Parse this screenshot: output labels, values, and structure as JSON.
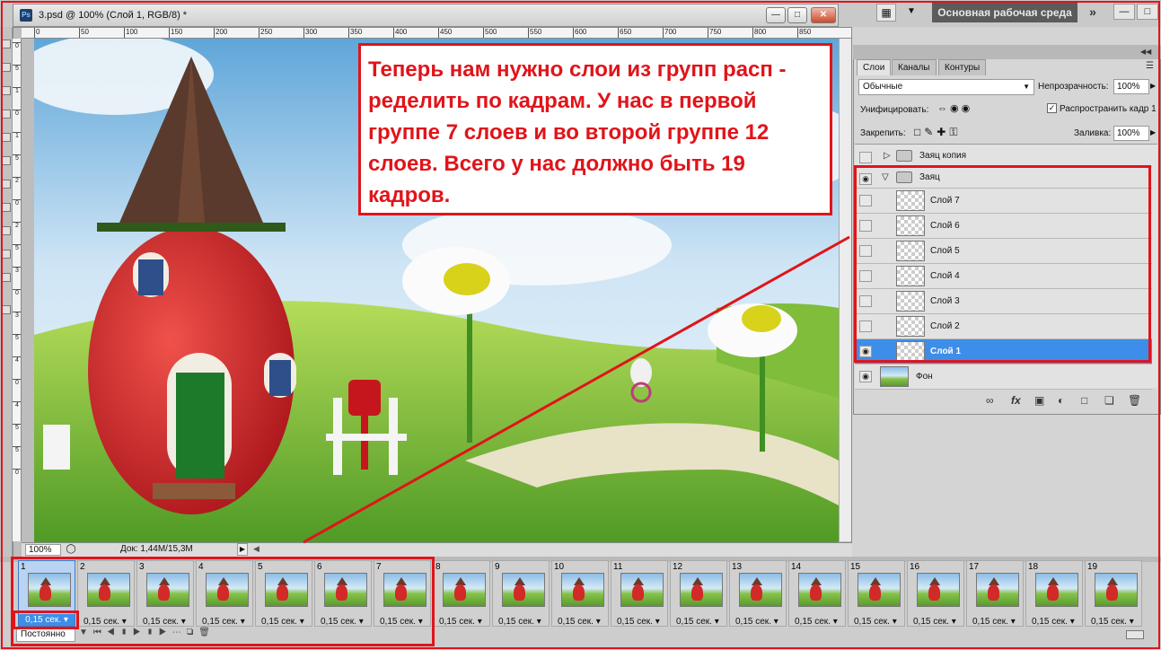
{
  "document": {
    "title": "3.psd @ 100% (Слой 1, RGB/8) *",
    "zoom": "100%",
    "doc_size": "Док: 1,44M/15,3M",
    "ruler_top": [
      "0",
      "50",
      "100",
      "150",
      "200",
      "250",
      "300",
      "350",
      "400",
      "450",
      "500",
      "550",
      "600",
      "650",
      "700",
      "750",
      "800",
      "850"
    ],
    "ruler_left": [
      "0",
      "5",
      "1",
      "0",
      "1",
      "5",
      "2",
      "0",
      "2",
      "5",
      "3",
      "0",
      "3",
      "5",
      "4",
      "0",
      "4",
      "5",
      "5",
      "0"
    ]
  },
  "workspace": {
    "label": "Основная рабочая среда"
  },
  "annotation": {
    "text": "Теперь нам нужно слои из групп расп -\nределить по кадрам. У нас в первой\nгруппе 7 слоев и во второй группе 12\nслоев. Всего у нас должно быть 19\nкадров."
  },
  "layers_panel": {
    "tabs": [
      "Слои",
      "Каналы",
      "Контуры"
    ],
    "blend_mode": "Обычные",
    "opacity_label": "Непрозрачность:",
    "opacity": "100%",
    "unify_label": "Унифицировать:",
    "propagate_label": "Распространить кадр 1",
    "lock_label": "Закрепить:",
    "fill_label": "Заливка:",
    "fill": "100%",
    "layers": [
      {
        "name": "Заяц копия",
        "type": "group",
        "visible": false,
        "expanded": false
      },
      {
        "name": "Заяц",
        "type": "group",
        "visible": true,
        "expanded": true
      },
      {
        "name": "Слой 7",
        "type": "layer",
        "visible": false
      },
      {
        "name": "Слой 6",
        "type": "layer",
        "visible": false
      },
      {
        "name": "Слой 5",
        "type": "layer",
        "visible": false
      },
      {
        "name": "Слой 4",
        "type": "layer",
        "visible": false
      },
      {
        "name": "Слой 3",
        "type": "layer",
        "visible": false
      },
      {
        "name": "Слой 2",
        "type": "layer",
        "visible": false
      },
      {
        "name": "Слой 1",
        "type": "layer",
        "visible": true,
        "selected": true
      },
      {
        "name": "Фон",
        "type": "background",
        "visible": true
      }
    ]
  },
  "animation": {
    "frames": [
      "1",
      "2",
      "3",
      "4",
      "5",
      "6",
      "7",
      "8",
      "9",
      "10",
      "11",
      "12",
      "13",
      "14",
      "15",
      "16",
      "17",
      "18",
      "19"
    ],
    "delay": "0,15 сек.",
    "selected_frame": "1",
    "loop": "Постоянно"
  },
  "colors": {
    "highlight": "#e0141a",
    "selection": "#3d8ee8"
  }
}
